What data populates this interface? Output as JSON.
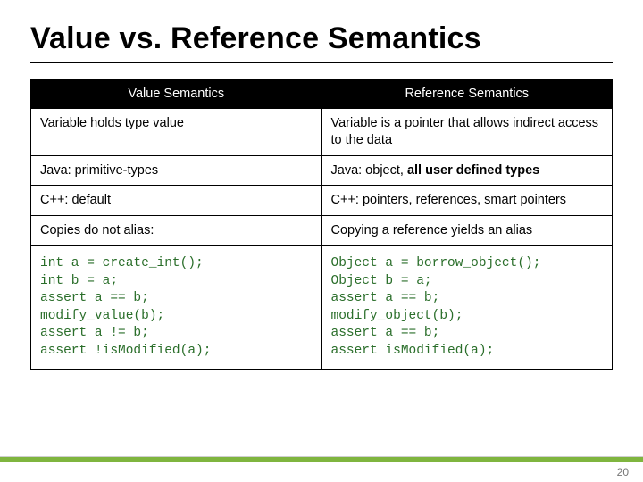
{
  "title": "Value vs. Reference Semantics",
  "table": {
    "headers": {
      "left": "Value Semantics",
      "right": "Reference Semantics"
    },
    "rows": [
      {
        "left": "Variable holds type value",
        "right": "Variable is a pointer that allows indirect access to the data"
      },
      {
        "left": "Java: primitive-types",
        "right_prefix": "Java: object, ",
        "right_bold": "all user defined types"
      },
      {
        "left": "C++: default",
        "right": "C++: pointers, references, smart pointers"
      },
      {
        "left": "Copies do not alias:",
        "right": "Copying a reference yields an alias"
      }
    ],
    "code": {
      "left": "int a = create_int();\nint b = a;\nassert a == b;\nmodify_value(b);\nassert a != b;\nassert !isModified(a);",
      "right": "Object a = borrow_object();\nObject b = a;\nassert a == b;\nmodify_object(b);\nassert a == b;\nassert isModified(a);"
    }
  },
  "page_number": "20"
}
